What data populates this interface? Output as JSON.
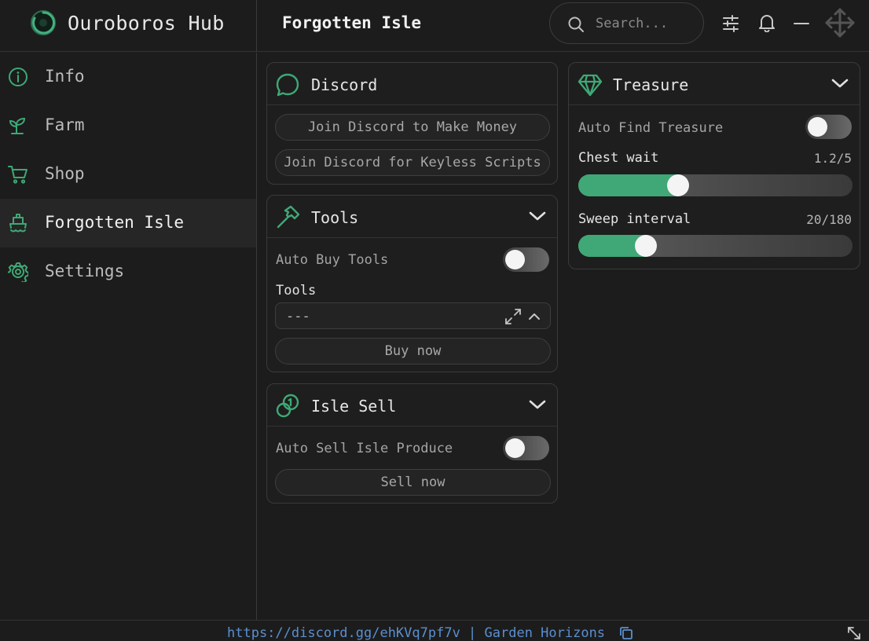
{
  "app": {
    "name": "Ouroboros Hub"
  },
  "header": {
    "title": "Forgotten Isle",
    "search_placeholder": "Search...",
    "icons": [
      "sliders-icon",
      "bell-icon",
      "minimize-icon",
      "move-icon"
    ]
  },
  "sidebar": {
    "items": [
      {
        "label": "Info",
        "icon": "info-icon",
        "active": false
      },
      {
        "label": "Farm",
        "icon": "sprout-icon",
        "active": false
      },
      {
        "label": "Shop",
        "icon": "cart-icon",
        "active": false
      },
      {
        "label": "Forgotten Isle",
        "icon": "ship-icon",
        "active": true
      },
      {
        "label": "Settings",
        "icon": "gear-icon",
        "active": false
      }
    ]
  },
  "discord": {
    "title": "Discord",
    "button_money": "Join Discord to Make Money",
    "button_keyless": "Join Discord for Keyless Scripts"
  },
  "tools": {
    "title": "Tools",
    "auto_buy_label": "Auto Buy Tools",
    "auto_buy_on": false,
    "dropdown_label": "Tools",
    "dropdown_value": "---",
    "buy_button": "Buy now"
  },
  "isle_sell": {
    "title": "Isle Sell",
    "auto_sell_label": "Auto Sell Isle Produce",
    "auto_sell_on": false,
    "sell_button": "Sell now"
  },
  "treasure": {
    "title": "Treasure",
    "auto_find_label": "Auto Find Treasure",
    "auto_find_on": false,
    "chest_wait": {
      "label": "Chest wait",
      "value": 1.2,
      "max": 5,
      "display": "1.2/5"
    },
    "sweep_interval": {
      "label": "Sweep interval",
      "value": 20,
      "max": 180,
      "display": "20/180"
    }
  },
  "footer": {
    "text": "https://discord.gg/ehKVq7pf7v | Garden Horizons"
  },
  "colors": {
    "accent": "#3fa876",
    "background": "#1c1c1c",
    "link": "#5a8fd0"
  }
}
